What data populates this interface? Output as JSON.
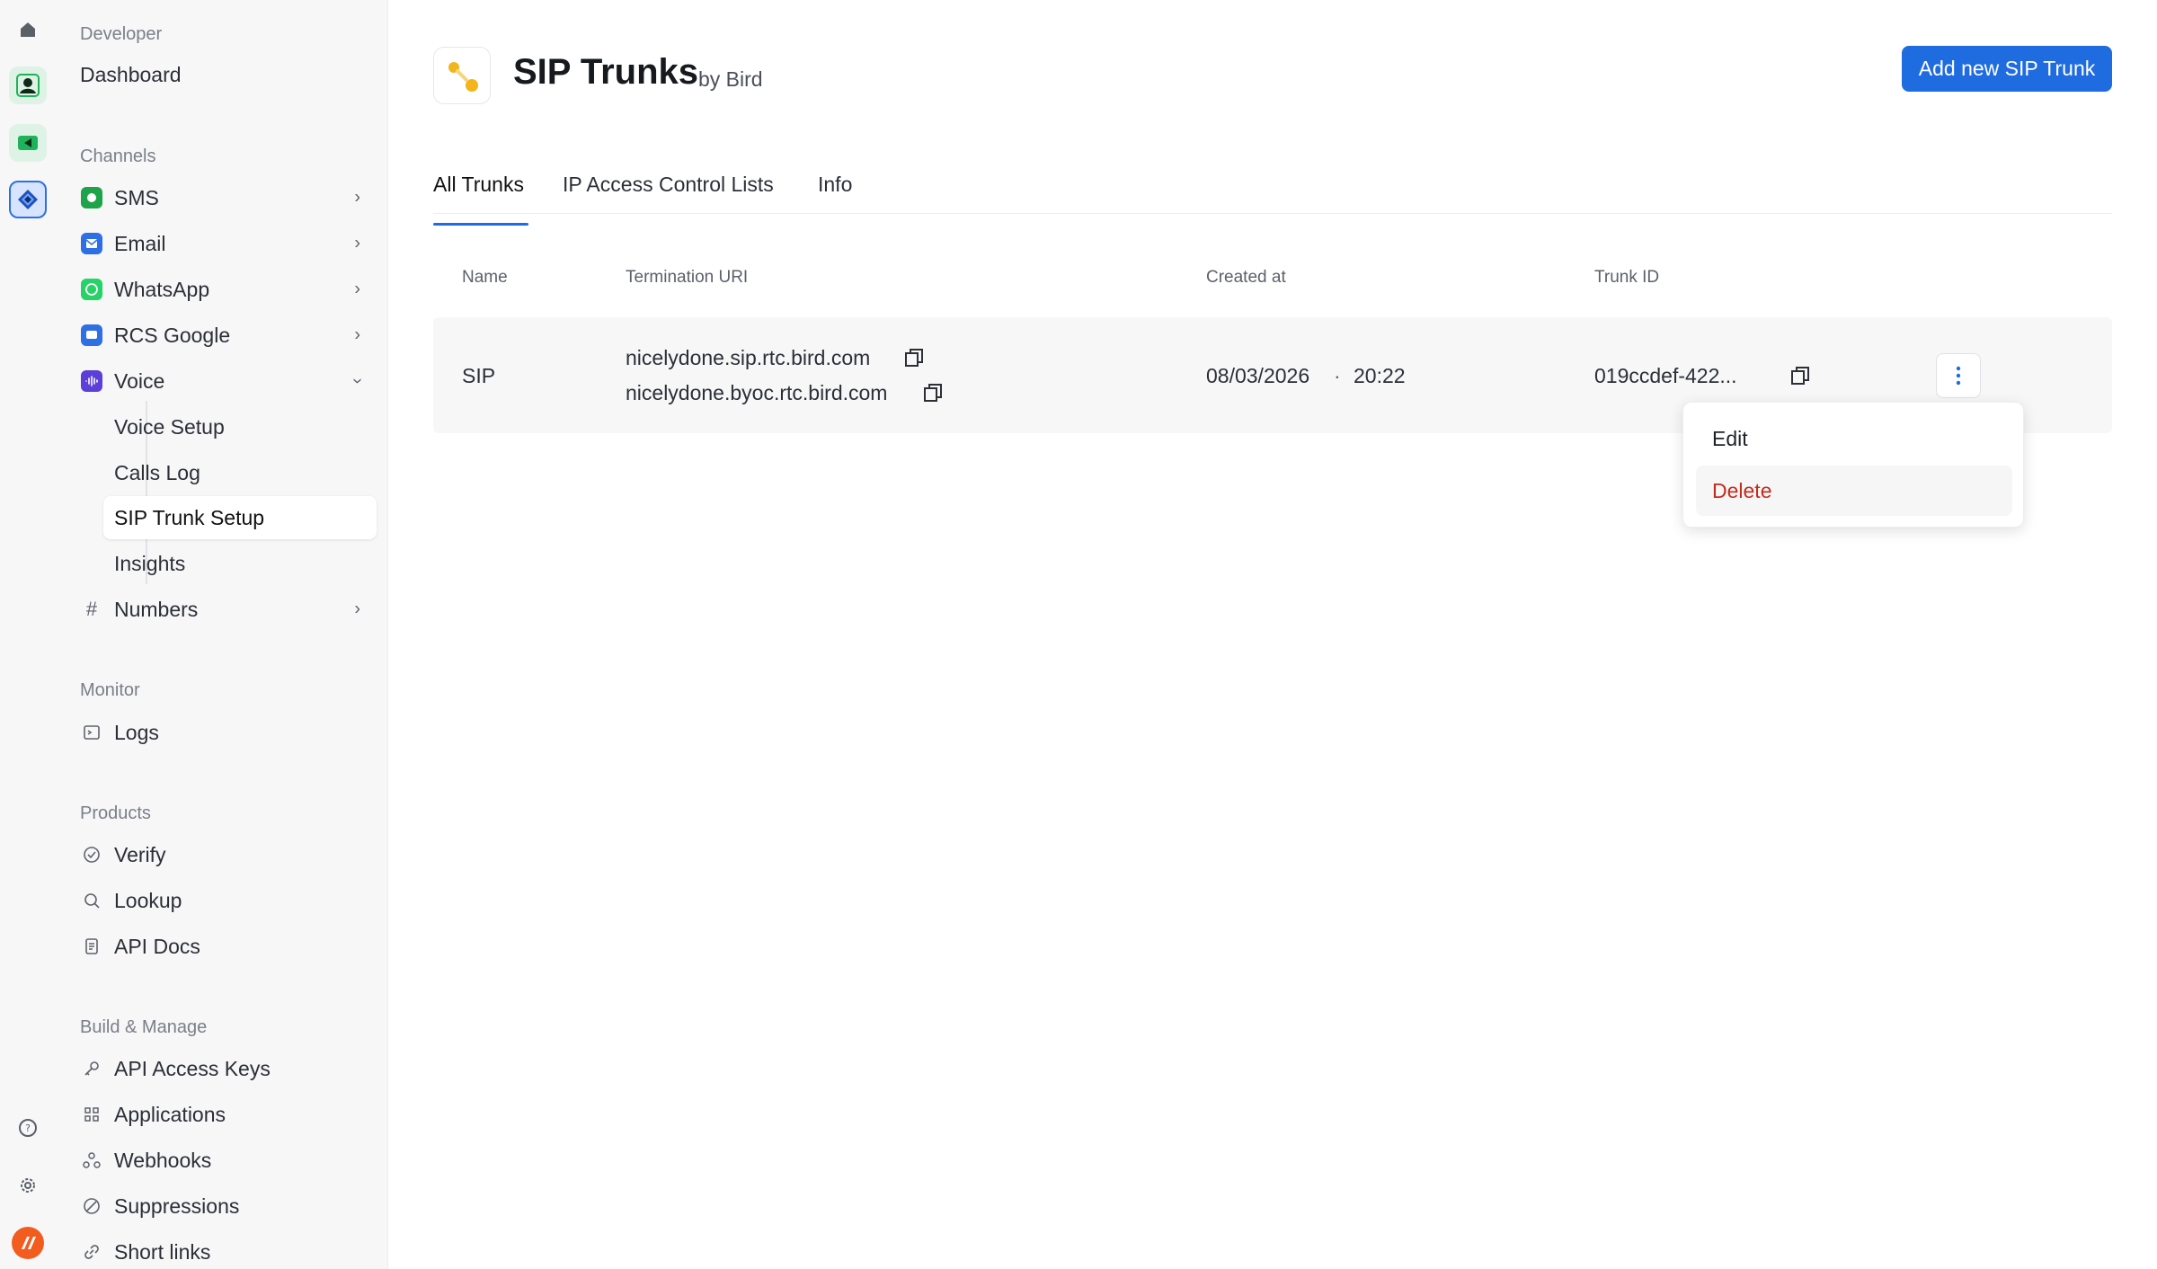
{
  "rail": {
    "items": [
      "home-icon",
      "contacts-icon",
      "video-icon",
      "developer-icon",
      "help-icon",
      "settings-icon",
      "account-icon"
    ]
  },
  "sidebar": {
    "developer_title": "Developer",
    "dashboard": "Dashboard",
    "channels_title": "Channels",
    "channels": [
      {
        "label": "SMS",
        "color": "#1fa34a"
      },
      {
        "label": "Email",
        "color": "#2f6fe4"
      },
      {
        "label": "WhatsApp",
        "color": "#25d366"
      },
      {
        "label": "RCS Google",
        "color": "#2f6fe4"
      },
      {
        "label": "Voice",
        "color": "#5b3fd8"
      }
    ],
    "voice_sub": [
      "Voice Setup",
      "Calls Log",
      "SIP Trunk Setup",
      "Insights"
    ],
    "numbers": "Numbers",
    "monitor_title": "Monitor",
    "logs": "Logs",
    "products_title": "Products",
    "products": [
      "Verify",
      "Lookup",
      "API Docs"
    ],
    "build_title": "Build & Manage",
    "build": [
      "API Access Keys",
      "Applications",
      "Webhooks",
      "Suppressions",
      "Short links"
    ]
  },
  "header": {
    "title": "SIP Trunks",
    "by": "by Bird",
    "add_button": "Add new SIP Trunk"
  },
  "tabs": [
    "All Trunks",
    "IP Access Control Lists",
    "Info"
  ],
  "table": {
    "columns": [
      "Name",
      "Termination URI",
      "Created at",
      "Trunk ID"
    ],
    "rows": [
      {
        "name": "SIP",
        "uri1": "nicelydone.sip.rtc.bird.com",
        "uri2": "nicelydone.byoc.rtc.bird.com",
        "date": "08/03/2026",
        "time": "20:22",
        "trunk_id": "019ccdef-422..."
      }
    ]
  },
  "menu": {
    "edit": "Edit",
    "delete": "Delete"
  },
  "colors": {
    "accent": "#1f6be0",
    "danger": "#c42b1c"
  }
}
